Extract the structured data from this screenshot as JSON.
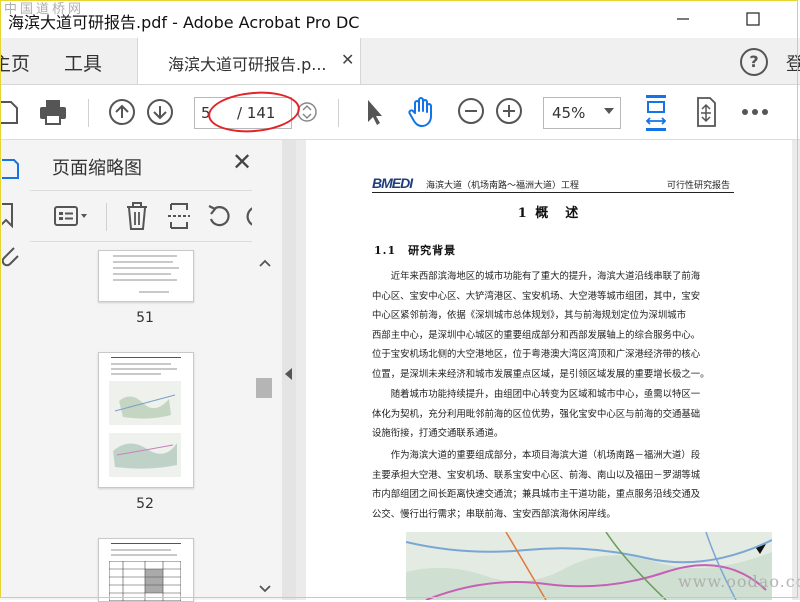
{
  "window": {
    "title": "海滨大道可研报告.pdf - Adobe Acrobat Pro DC",
    "watermark_top": "中国道桥网",
    "watermark_bottom": "www.oodao.com"
  },
  "nav": {
    "home_label": "主页",
    "tools_label": "工具",
    "document_tab": "海滨大道可研报告.p...",
    "help_symbol": "?",
    "signin_truncated": "登"
  },
  "toolbar": {
    "current_page": "5",
    "page_total": "/ 141",
    "zoom": "45%"
  },
  "thumbnails": {
    "panel_title": "页面缩略图",
    "pages": [
      "51",
      "52"
    ]
  },
  "document": {
    "header_logo": "BMEDI",
    "header_title": "海滨大道（机场南路～福洲大道）工程",
    "header_right": "可行性研究报告",
    "chapter_title": "1 概　述",
    "section_title": "1.1　研究背景",
    "para1": [
      "　　近年来西部滨海地区的城市功能有了重大的提升，海滨大道沿线串联了前海",
      "中心区、宝安中心区、大铲湾港区、宝安机场、大空港等城市组团，其中，宝安",
      "中心区紧邻前海，依据《深圳城市总体规划》，其与前海规划定位为深圳城市",
      "西部主中心，是深圳中心城区的重要组成部分和西部发展轴上的综合服务中心。",
      "位于宝安机场北侧的大空港地区，位于粤港澳大湾区湾顶和广深港经济带的核心",
      "位置，是深圳未来经济和城市发展重点区域，是引领区域发展的重要增长极之一。"
    ],
    "para2": [
      "　　随着城市功能持续提升，由组团中心转变为区域和城市中心，亟需以特区一",
      "体化为契机，充分利用毗邻前海的区位优势，强化宝安中心区与前海的交通基础",
      "设施衔接，打通交通联系通道。"
    ],
    "para3": [
      "　　作为海滨大道的重要组成部分，本项目海滨大道（机场南路－福洲大道）段",
      "主要承担大空港、宝安机场、联系宝安中心区、前海、南山以及福田－罗湖等城",
      "市内部组团之间长距离快速交通流；兼具城市主干道功能，重点服务沿线交通及",
      "公交、慢行出行需求；串联前海、宝安西部滨海休闲岸线。"
    ]
  },
  "colors": {
    "accent_blue": "#1473e6",
    "annotation_red": "#e0242a",
    "panel_bg": "#f4f4f4"
  },
  "icons": [
    "print-icon",
    "page-up-icon",
    "page-down-icon",
    "select-cursor-icon",
    "hand-tool-icon",
    "zoom-out-icon",
    "zoom-in-icon",
    "fit-page-icon",
    "scroll-mode-icon",
    "more-icon",
    "options-menu-icon",
    "delete-icon",
    "extract-icon",
    "undo-icon",
    "redo-icon"
  ]
}
